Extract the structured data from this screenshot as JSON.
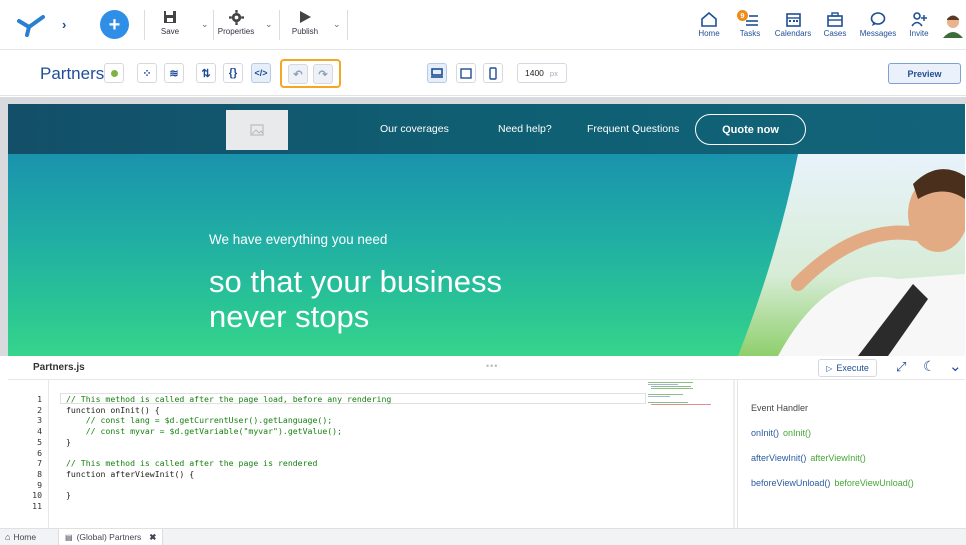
{
  "topbar": {
    "save_label": "Save",
    "properties_label": "Properties",
    "publish_label": "Publish",
    "tasks_badge": "9",
    "nav": {
      "home": "Home",
      "tasks": "Tasks",
      "calendars": "Calendars",
      "cases": "Cases",
      "messages": "Messages",
      "invite": "Invite"
    }
  },
  "subbar": {
    "title": "Partners",
    "width_value": "1400",
    "width_unit": "px",
    "preview_label": "Preview"
  },
  "site": {
    "nav_links": [
      "Our coverages",
      "Need help?",
      "Frequent Questions"
    ],
    "cta": "Quote now",
    "hero_small": "We have everything you need",
    "hero_line1": "so that your business",
    "hero_line2": "never stops"
  },
  "editor": {
    "filename": "Partners.js",
    "execute_label": "Execute",
    "line_numbers": [
      "1",
      "2",
      "3",
      "4",
      "5",
      "6",
      "7",
      "8",
      "9",
      "10",
      "11"
    ],
    "code_lines": [
      {
        "type": "comment",
        "text": "// This method is called after the page load, before any rendering"
      },
      {
        "type": "code",
        "text": "function onInit() {"
      },
      {
        "type": "comment",
        "text": "    // const lang = $d.getCurrentUser().getLanguage();"
      },
      {
        "type": "comment",
        "text": "    // const myvar = $d.getVariable(\"myvar\").getValue();"
      },
      {
        "type": "code",
        "text": "}"
      },
      {
        "type": "code",
        "text": ""
      },
      {
        "type": "comment",
        "text": "// This method is called after the page is rendered"
      },
      {
        "type": "code",
        "text": "function afterViewInit() {"
      },
      {
        "type": "code",
        "text": ""
      },
      {
        "type": "code",
        "text": "}"
      },
      {
        "type": "code",
        "text": ""
      }
    ]
  },
  "events": {
    "title": "Event Handler",
    "items": [
      {
        "method": "onInit()",
        "handler": "onInit()"
      },
      {
        "method": "afterViewInit()",
        "handler": "afterViewInit()"
      },
      {
        "method": "beforeViewUnload()",
        "handler": "beforeViewUnload()"
      }
    ]
  },
  "bottom_tabs": {
    "home": "Home",
    "page": "(Global) Partners"
  },
  "colors": {
    "accent": "#1f4e96",
    "highlight": "#f5a623",
    "comment": "#17820f",
    "handler": "#45a535"
  }
}
